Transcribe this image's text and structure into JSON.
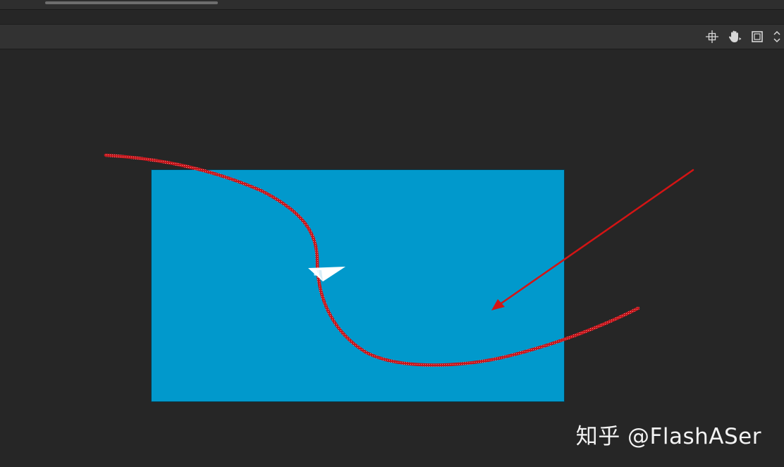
{
  "top": {
    "scrollbar": "horizontal-scrollbar"
  },
  "toolbar": {
    "tools": [
      {
        "name": "snap-to-objects",
        "icon": "crosshair-icon"
      },
      {
        "name": "hand-tool",
        "icon": "hand-icon"
      },
      {
        "name": "clip-stage",
        "icon": "frame-icon"
      },
      {
        "name": "zoom-stepper",
        "icon": "chevron-updown-icon"
      }
    ]
  },
  "stage": {
    "background_color": "#0199cc",
    "objects": [
      {
        "name": "paper-plane",
        "icon": "paper-plane-icon",
        "color": "#ffffff"
      }
    ],
    "annotations": {
      "motion_path_color": "#cc1a1a",
      "arrow_color": "#d41414"
    }
  },
  "watermark": {
    "text": "知乎 @FlashASer"
  }
}
